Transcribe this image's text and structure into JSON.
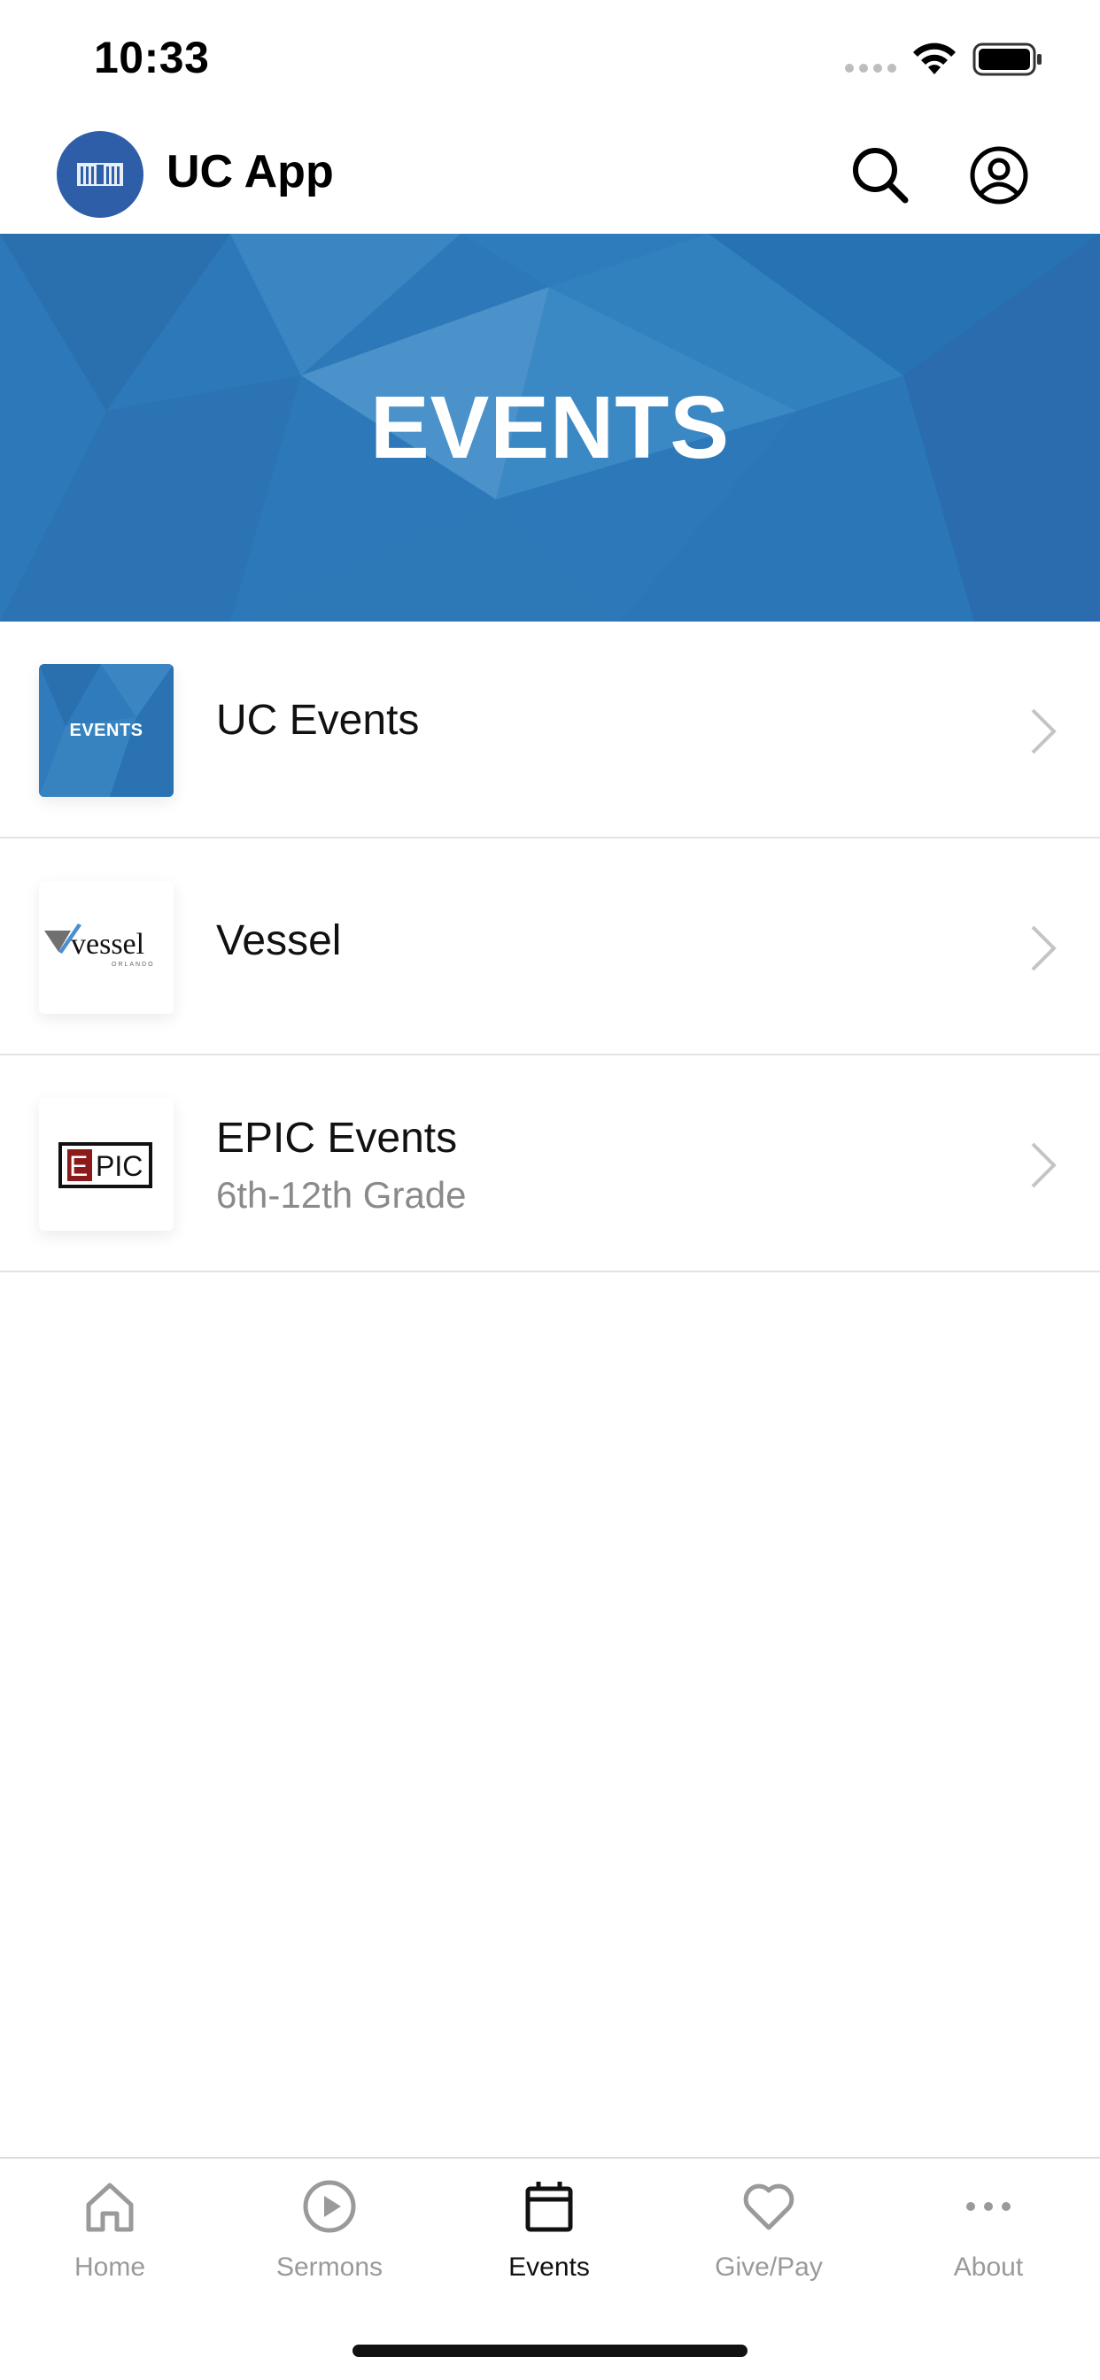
{
  "status_bar": {
    "time": "10:33"
  },
  "header": {
    "app_title": "UC App",
    "icons": [
      "app-logo-icon",
      "search-icon",
      "profile-icon"
    ]
  },
  "banner": {
    "title": "EVENTS",
    "color": "#2d78b8"
  },
  "list": {
    "items": [
      {
        "title": "UC Events",
        "subtitle": "",
        "thumb_text": "EVENTS"
      },
      {
        "title": "Vessel",
        "subtitle": "",
        "thumb_text": "vessel",
        "thumb_subtext": "ORLANDO"
      },
      {
        "title": "EPIC Events",
        "subtitle": "6th-12th Grade",
        "thumb_text": "EPIC"
      }
    ]
  },
  "tab_bar": {
    "tabs": [
      {
        "label": "Home",
        "icon": "home-icon",
        "active": false
      },
      {
        "label": "Sermons",
        "icon": "play-icon",
        "active": false
      },
      {
        "label": "Events",
        "icon": "calendar-icon",
        "active": true
      },
      {
        "label": "Give/Pay",
        "icon": "heart-icon",
        "active": false
      },
      {
        "label": "About",
        "icon": "more-icon",
        "active": false
      }
    ],
    "active_color": "#111111",
    "inactive_color": "#9a9a9a"
  }
}
